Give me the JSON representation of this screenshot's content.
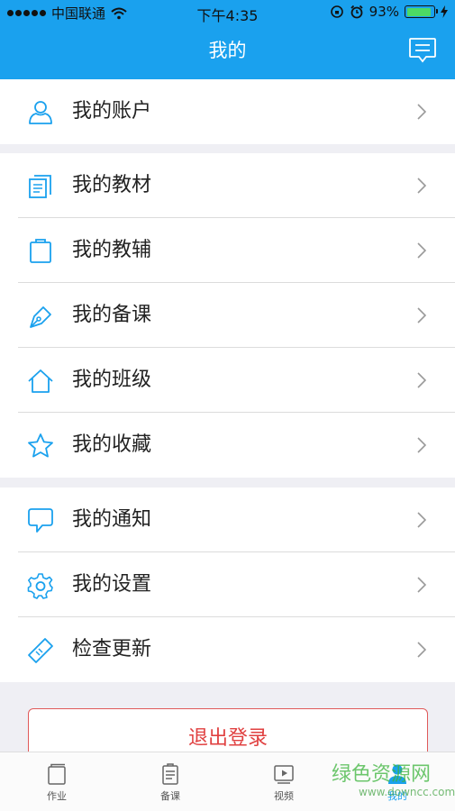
{
  "status_bar": {
    "carrier": "中国联通",
    "time": "下午4:35",
    "battery": "93%",
    "battery_level": 0.93
  },
  "header": {
    "title": "我的",
    "message_icon": "message-icon"
  },
  "groups": [
    {
      "items": [
        {
          "label": "我的账户",
          "icon": "user-icon"
        }
      ]
    },
    {
      "items": [
        {
          "label": "我的教材",
          "icon": "textbook-icon"
        },
        {
          "label": "我的教辅",
          "icon": "clipboard-icon"
        },
        {
          "label": "我的备课",
          "icon": "pen-icon"
        },
        {
          "label": "我的班级",
          "icon": "home-icon"
        },
        {
          "label": "我的收藏",
          "icon": "star-icon"
        }
      ]
    },
    {
      "items": [
        {
          "label": "我的通知",
          "icon": "chat-bubble-icon"
        },
        {
          "label": "我的设置",
          "icon": "gear-icon"
        },
        {
          "label": "检查更新",
          "icon": "tag-icon"
        }
      ]
    }
  ],
  "logout_label": "退出登录",
  "tabs": [
    {
      "label": "作业",
      "icon": "book-icon",
      "active": false
    },
    {
      "label": "备课",
      "icon": "document-icon",
      "active": false
    },
    {
      "label": "视频",
      "icon": "video-icon",
      "active": false
    },
    {
      "label": "我的",
      "icon": "profile-icon",
      "active": true
    }
  ],
  "watermark": {
    "title": "绿色资源网",
    "subtitle": "www.downcc.com"
  },
  "colors": {
    "primary": "#1aa1ee",
    "danger": "#e04040",
    "background": "#efeff4"
  }
}
